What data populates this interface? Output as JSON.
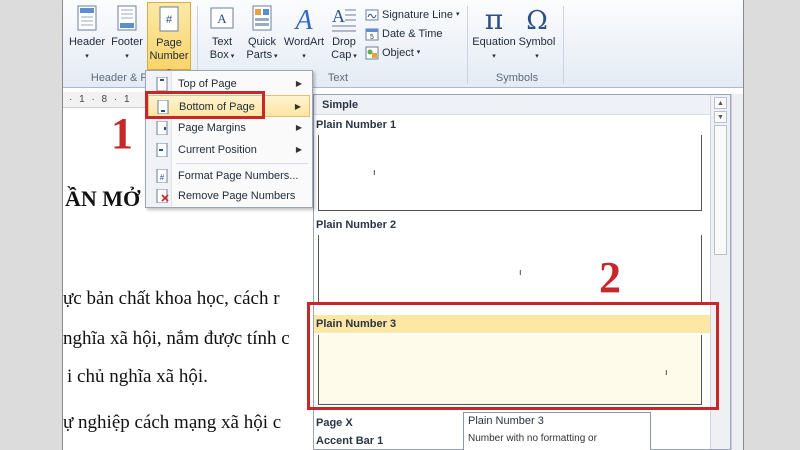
{
  "ribbon": {
    "header": "Header",
    "footer": "Footer",
    "page_number": [
      "Page",
      "Number"
    ],
    "text_box": [
      "Text",
      "Box"
    ],
    "quick_parts": [
      "Quick",
      "Parts"
    ],
    "wordart": "WordArt",
    "drop_cap": [
      "Drop",
      "Cap"
    ],
    "signature_line": "Signature Line",
    "date_time": "Date & Time",
    "object": "Object",
    "equation": "Equation",
    "symbol": "Symbol",
    "group_header": "Header & F",
    "group_text": "Text",
    "group_symbols": "Symbols"
  },
  "ruler_text": "· 1 · 8 · 1",
  "menu": {
    "items": [
      {
        "label": "Top of Page"
      },
      {
        "label": "Bottom of Page"
      },
      {
        "label": "Page Margins"
      },
      {
        "label": "Current Position"
      },
      {
        "label": "Format Page Numbers..."
      },
      {
        "label": "Remove Page Numbers"
      }
    ]
  },
  "gallery": {
    "section": "Simple",
    "items": [
      {
        "title": "Plain Number 1"
      },
      {
        "title": "Plain Number 2"
      },
      {
        "title": "Plain Number 3"
      },
      {
        "title": "Page X"
      },
      {
        "title": "Accent Bar 1"
      }
    ],
    "mark": "ı"
  },
  "tooltip": {
    "title": "Plain Number 3",
    "text": "Number with no formatting or"
  },
  "annotations": {
    "one": "1",
    "two": "2"
  },
  "document": {
    "heading": "ẦN MỞ ĐẦU",
    "lines": [
      "ực bản chất khoa học, cách r",
      "nghĩa xã hội, nắm được tính c",
      "i chủ nghĩa xã hội.",
      "ự nghiệp cách mạng xã hội c"
    ]
  }
}
